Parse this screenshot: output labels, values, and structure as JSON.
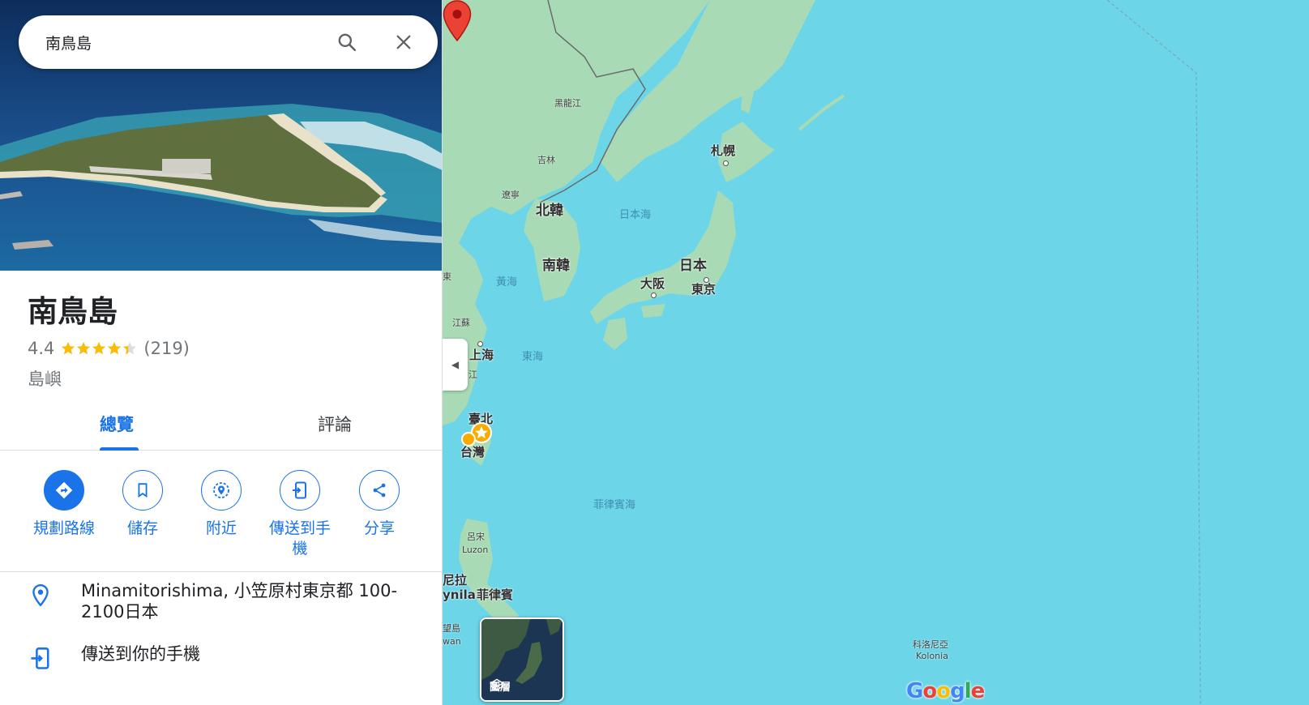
{
  "search": {
    "value": "南鳥島"
  },
  "place": {
    "title": "南鳥島",
    "rating": "4.4",
    "rating_stars": 4.4,
    "review_count": "(219)",
    "type": "島嶼"
  },
  "tabs": [
    {
      "label": "總覽",
      "active": true
    },
    {
      "label": "評論",
      "active": false
    }
  ],
  "actions": [
    {
      "label": "規劃路線",
      "icon": "directions-icon"
    },
    {
      "label": "儲存",
      "icon": "bookmark-icon"
    },
    {
      "label": "附近",
      "icon": "nearby-icon"
    },
    {
      "label": "傳送到手機",
      "icon": "send-to-phone-icon"
    },
    {
      "label": "分享",
      "icon": "share-icon"
    }
  ],
  "info": {
    "address": "Minamitorishima, 小笠原村東京都 100-2100日本",
    "send_to_phone": "傳送到你的手機"
  },
  "map": {
    "labels": {
      "heilongjiang": "黑龍江",
      "jilin": "吉林",
      "liaoning": "遼寧",
      "north_korea": "北韓",
      "south_korea": "南韓",
      "sea_of_japan": "日本海",
      "yellow_sea": "黃海",
      "east_sea": "東海",
      "sapporo": "札幌",
      "japan": "日本",
      "osaka": "大阪",
      "tokyo": "東京",
      "shandong_partial": "東",
      "jiangsu": "江蘇",
      "shanghai": "上海",
      "zhejiang_partial": "江",
      "taipei": "臺北",
      "taiwan": "台灣",
      "philippine_sea": "菲律賓海",
      "luzon_cn": "呂宋",
      "luzon_en": "Luzon",
      "manila_cn": "尼拉",
      "manila_en": "ynila",
      "philippines_partial": "菲律賓",
      "mindoro_cn": "望島",
      "mindoro_en": "wan",
      "kolonia_cn": "科洛尼亞",
      "kolonia_en": "Kolonia"
    },
    "layers_label": "圖層",
    "google_logo": "Google"
  },
  "colors": {
    "accent": "#1a73e8",
    "water": "#6dd5e8",
    "land": "#a8dbb5",
    "pin": "#ea4335",
    "star": "#fbbc04"
  }
}
